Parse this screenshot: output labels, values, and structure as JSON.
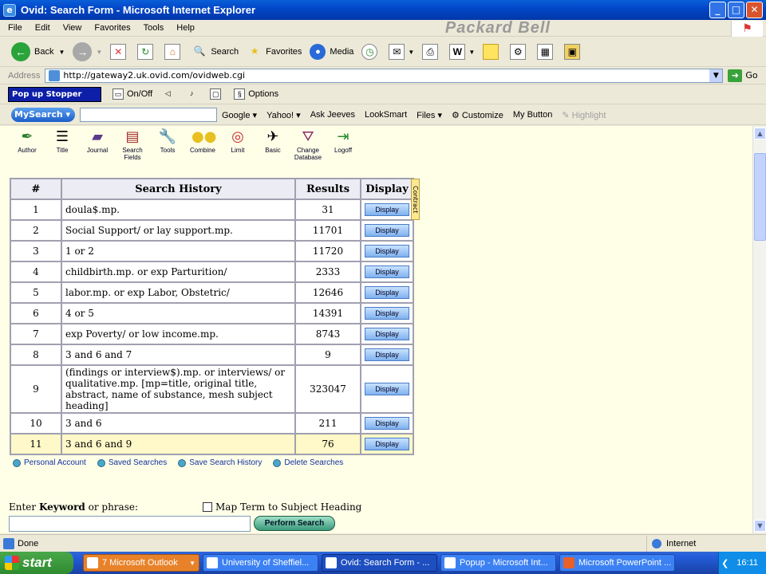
{
  "window": {
    "title": "Ovid: Search Form - Microsoft Internet Explorer"
  },
  "menu": [
    "File",
    "Edit",
    "View",
    "Favorites",
    "Tools",
    "Help"
  ],
  "brand": "Packard Bell",
  "toolbar": {
    "back": "Back",
    "search": "Search",
    "favorites": "Favorites",
    "media": "Media"
  },
  "address": {
    "label": "Address",
    "url": "http://gateway2.uk.ovid.com/ovidweb.cgi",
    "go": "Go"
  },
  "popup": {
    "title": "Pop up Stopper",
    "onoff": "On/Off",
    "options": "Options"
  },
  "mysearch": {
    "label": "MySearch",
    "items": [
      "Google",
      "Yahoo!",
      "Ask Jeeves",
      "LookSmart",
      "Files",
      "Customize",
      "My Button",
      "Highlight"
    ]
  },
  "ovid_tools": [
    "Author",
    "Title",
    "Journal",
    "Search Fields",
    "Tools",
    "Combine",
    "Limit",
    "Basic",
    "Change Database",
    "Logoff"
  ],
  "history": {
    "headers": {
      "num": "#",
      "query": "Search History",
      "results": "Results",
      "display": "Display"
    },
    "display_label": "Display",
    "contract": "Contract",
    "rows": [
      {
        "num": "1",
        "query": "doula$.mp.",
        "results": "31"
      },
      {
        "num": "2",
        "query": "Social Support/ or lay support.mp.",
        "results": "11701"
      },
      {
        "num": "3",
        "query": "1 or 2",
        "results": "11720"
      },
      {
        "num": "4",
        "query": "childbirth.mp. or exp Parturition/",
        "results": "2333"
      },
      {
        "num": "5",
        "query": "labor.mp. or exp Labor, Obstetric/",
        "results": "12646"
      },
      {
        "num": "6",
        "query": "4 or 5",
        "results": "14391"
      },
      {
        "num": "7",
        "query": "exp Poverty/ or low income.mp.",
        "results": "8743"
      },
      {
        "num": "8",
        "query": "3 and 6 and 7",
        "results": "9"
      },
      {
        "num": "9",
        "query": "(findings or interview$).mp. or interviews/ or qualitative.mp. [mp=title, original title, abstract, name of substance, mesh subject heading]",
        "results": "323047"
      },
      {
        "num": "10",
        "query": "3 and 6",
        "results": "211"
      },
      {
        "num": "11",
        "query": "3 and 6 and 9",
        "results": "76"
      }
    ]
  },
  "links": [
    "Personal Account",
    "Saved Searches",
    "Save Search History",
    "Delete Searches"
  ],
  "keyword": {
    "label_pre": "Enter ",
    "label_bold": "Keyword",
    "label_post": " or phrase:",
    "map_term": "Map Term to Subject Heading",
    "value": "",
    "perform": "Perform Search"
  },
  "status": {
    "text": "Done",
    "zone": "Internet"
  },
  "taskbar": {
    "start": "start",
    "tasks": [
      "7 Microsoft Outlook",
      "University of Sheffiel...",
      "Ovid: Search Form - ...",
      "Popup - Microsoft Int...",
      "Microsoft PowerPoint ..."
    ],
    "clock": "16:11"
  }
}
